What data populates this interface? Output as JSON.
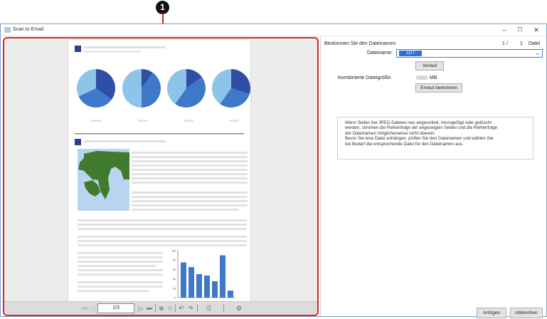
{
  "callout": {
    "number": "1"
  },
  "window": {
    "title": "Scan to Email",
    "controls": {
      "minimize": "–",
      "maximize": "☐",
      "close": "✕"
    }
  },
  "preview": {
    "page_input": "1/3"
  },
  "panel": {
    "heading": "Bestimmen Sie den Dateinamen",
    "counter": {
      "current": "1 /",
      "total": "1",
      "unit": "Datei"
    },
    "filename_label": "Dateiname:",
    "filename_value": "1117",
    "history_button": "Verlauf",
    "size_label": "Kombinierte Dateigröße:",
    "size_unit": "MB",
    "recalc_button": "Erneut berechnen",
    "info_lines": [
      "Wenn Seiten bei JPEG-Dateien neu angeordnet, hinzugefügt oder gelöscht",
      "werden, stimmen die Reihenfolge der angezeigten Seiten und die Reihenfolge",
      "der Dateinamen möglicherweise nicht überein.",
      "Bevor Sie eine Datei anhängen, prüfen Sie den Dateinamen und wählen Sie",
      "bei Bedarf die entsprechende Datei für den Dateinamen aus."
    ],
    "attach_button": "Anfügen",
    "cancel_button": "Abbrechen"
  },
  "page_chart_axis": [
    "100",
    "80",
    "60",
    "40",
    "20",
    "0"
  ],
  "colors": {
    "accent": "#2f6fd0",
    "highlight_border": "#d42a2a",
    "pie_dark": "#2f4fa6",
    "pie_mid": "#3d78c9",
    "pie_light": "#8cc4ea",
    "map_green": "#3f7a2f"
  }
}
